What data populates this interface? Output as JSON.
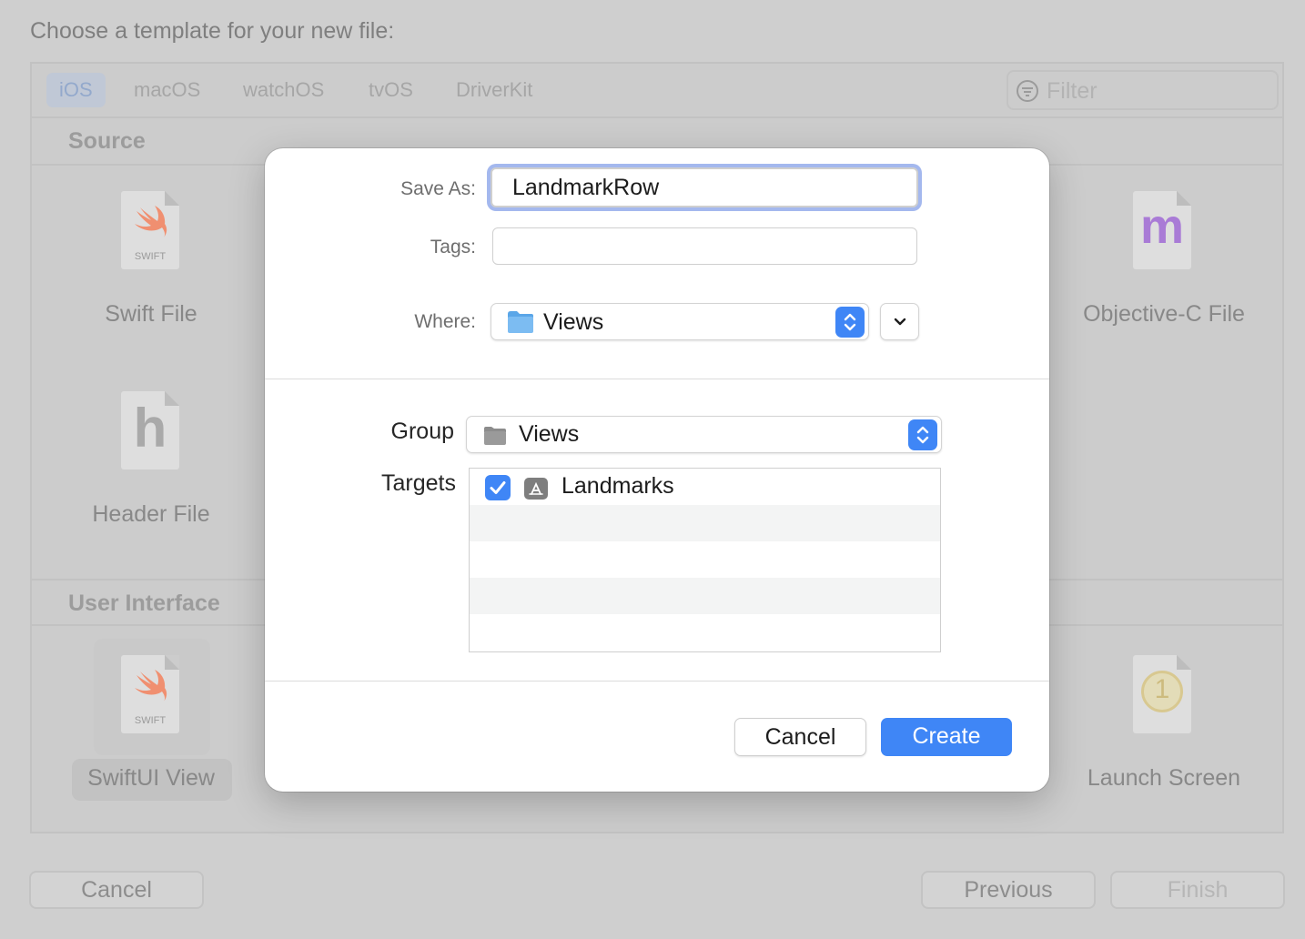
{
  "background": {
    "heading": "Choose a template for your new file:",
    "platform_tabs": [
      "iOS",
      "macOS",
      "watchOS",
      "tvOS",
      "DriverKit"
    ],
    "active_tab": "iOS",
    "filter_placeholder": "Filter",
    "sections": {
      "source": "Source",
      "user_interface": "User Interface"
    },
    "templates": {
      "swift_file": "Swift File",
      "objc_file": "Objective-C File",
      "header_file": "Header File",
      "swiftui_view": "SwiftUI View",
      "launch_screen": "Launch Screen"
    },
    "icon_captions": {
      "swift": "SWIFT",
      "objc_glyph": "m",
      "header_glyph": "h",
      "launch_glyph": "1"
    },
    "buttons": {
      "cancel": "Cancel",
      "previous": "Previous",
      "finish": "Finish"
    }
  },
  "dialog": {
    "save_as_label": "Save As:",
    "save_as_value": "LandmarkRow",
    "tags_label": "Tags:",
    "tags_value": "",
    "where_label": "Where:",
    "where_value": "Views",
    "group_label": "Group",
    "group_value": "Views",
    "targets_label": "Targets",
    "targets": [
      {
        "name": "Landmarks",
        "checked": true
      }
    ],
    "cancel_button": "Cancel",
    "create_button": "Create"
  },
  "colors": {
    "accent": "#3f86f6",
    "focus_ring": "#a4b8ee",
    "objc_purple": "#a97bd6",
    "swift_orange": "#f08f70"
  }
}
